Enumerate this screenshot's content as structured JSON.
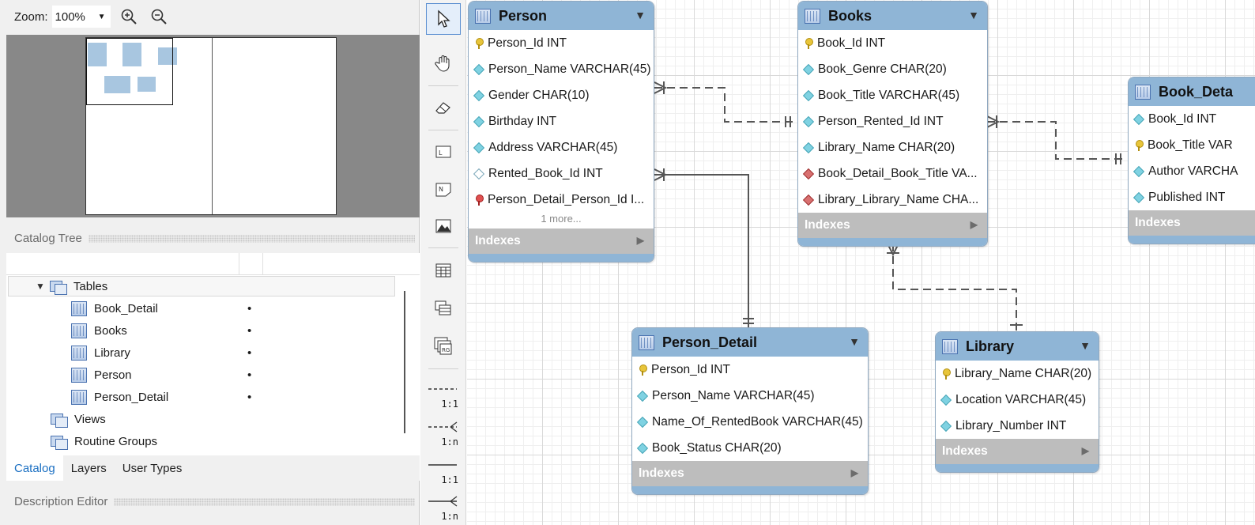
{
  "zoom": {
    "label": "Zoom:",
    "value": "100%"
  },
  "sections": {
    "catalog_tree": "Catalog Tree",
    "description_editor": "Description Editor"
  },
  "tree": {
    "tables_label": "Tables",
    "tables": [
      {
        "name": "Book_Detail",
        "bullet": "•"
      },
      {
        "name": "Books",
        "bullet": "•"
      },
      {
        "name": "Library",
        "bullet": "•"
      },
      {
        "name": "Person",
        "bullet": "•"
      },
      {
        "name": "Person_Detail",
        "bullet": "•"
      }
    ],
    "views_label": "Views",
    "routine_groups_label": "Routine Groups"
  },
  "tabs": [
    {
      "label": "Catalog",
      "active": true
    },
    {
      "label": "Layers",
      "active": false
    },
    {
      "label": "User Types",
      "active": false
    }
  ],
  "toolbar": {
    "tools": [
      "pointer-icon",
      "hand-icon",
      "eraser-icon",
      "layer-icon",
      "note-icon",
      "image-icon",
      "table-icon",
      "view-icon",
      "routine-group-icon"
    ],
    "relationships": [
      "1:1",
      "1:n",
      "1:1",
      "1:n"
    ]
  },
  "colors": {
    "header": "#8fb5d6",
    "indexes": "#bdbdbd",
    "active_tab": "#1a6fc2"
  },
  "er_tables": {
    "person": {
      "title": "Person",
      "columns": [
        "Person_Id INT",
        "Person_Name VARCHAR(45)",
        "Gender CHAR(10)",
        "Birthday INT",
        "Address VARCHAR(45)",
        "Rented_Book_Id INT",
        "Person_Detail_Person_Id I..."
      ],
      "more": "1 more...",
      "indexes": "Indexes"
    },
    "books": {
      "title": "Books",
      "columns": [
        "Book_Id INT",
        "Book_Genre CHAR(20)",
        "Book_Title VARCHAR(45)",
        "Person_Rented_Id INT",
        "Library_Name CHAR(20)",
        "Book_Detail_Book_Title VA...",
        "Library_Library_Name CHA..."
      ],
      "indexes": "Indexes"
    },
    "book_detail": {
      "title": "Book_Deta",
      "columns": [
        "Book_Id INT",
        "Book_Title VAR",
        "Author VARCHA",
        "Published INT"
      ],
      "indexes": "Indexes"
    },
    "person_detail": {
      "title": "Person_Detail",
      "columns": [
        "Person_Id INT",
        "Person_Name VARCHAR(45)",
        "Name_Of_RentedBook VARCHAR(45)",
        "Book_Status CHAR(20)"
      ],
      "indexes": "Indexes"
    },
    "library": {
      "title": "Library",
      "columns": [
        "Library_Name CHAR(20)",
        "Location VARCHAR(45)",
        "Library_Number INT"
      ],
      "indexes": "Indexes"
    }
  }
}
